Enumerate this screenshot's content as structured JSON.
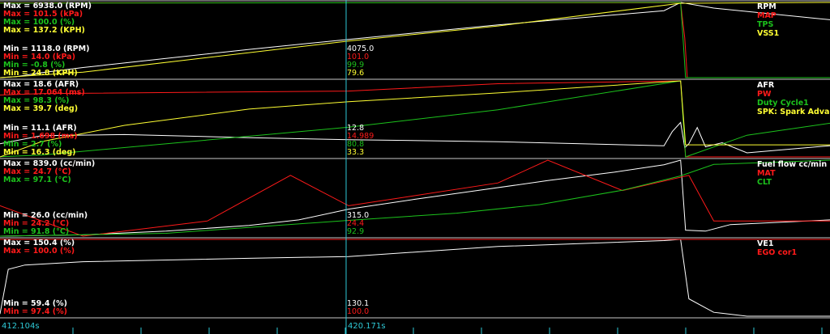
{
  "cursor": {
    "time_label": "420.171s",
    "time": 420.171
  },
  "time_axis": {
    "start_label": "412.104s"
  },
  "colors": {
    "white": "#ffffff",
    "red": "#ff1a1a",
    "green": "#1cc21c",
    "yellow": "#ffff33",
    "cursor": "#2ec9d6",
    "divider": "#c8c8c8"
  },
  "chart_data": [
    {
      "type": "line",
      "panel": "panel-1",
      "series": [
        {
          "name": "RPM",
          "color": "#ffffff",
          "max_label": "Max = 6938.0 (RPM)",
          "min_label": "Min = 1118.0 (RPM)",
          "cursor_value": "4075.0",
          "max": 6938.0,
          "min": 1118.0,
          "points": [
            [
              0,
              1118
            ],
            [
              0.02,
              1200
            ],
            [
              0.05,
              1500
            ],
            [
              0.1,
              1900
            ],
            [
              0.3,
              3300
            ],
            [
              0.42,
              4075
            ],
            [
              0.6,
              5200
            ],
            [
              0.8,
              6300
            ],
            [
              0.82,
              6938
            ],
            [
              0.86,
              6500
            ],
            [
              1.0,
              5600
            ]
          ]
        },
        {
          "name": "MAP",
          "color": "#ff1a1a",
          "max_label": "Max = 101.5 (kPa)",
          "min_label": "Min = 14.0 (kPa)",
          "cursor_value": "101.0",
          "max": 101.5,
          "min": 14.0,
          "points": [
            [
              0,
              101
            ],
            [
              0.82,
              101
            ],
            [
              0.825,
              60
            ],
            [
              0.828,
              14
            ],
            [
              1.0,
              14
            ]
          ]
        },
        {
          "name": "TPS",
          "color": "#1cc21c",
          "max_label": "Max = 100.0 (%)",
          "min_label": "Min = -0.8 (%)",
          "cursor_value": "99.9",
          "max": 100.0,
          "min": -0.8,
          "points": [
            [
              0,
              99
            ],
            [
              0.82,
              100
            ],
            [
              0.823,
              50
            ],
            [
              0.826,
              -0.8
            ],
            [
              1.0,
              -0.8
            ]
          ]
        },
        {
          "name": "VSS1",
          "color": "#ffff33",
          "max_label": "Max = 137.2 (KPH)",
          "min_label": "Min = 24.8 (KPH)",
          "cursor_value": "79.6",
          "max": 137.2,
          "min": 24.8,
          "points": [
            [
              0,
              24.8
            ],
            [
              0.1,
              33
            ],
            [
              0.42,
              79.6
            ],
            [
              0.6,
              102
            ],
            [
              0.82,
              136
            ],
            [
              1.0,
              137.2
            ]
          ]
        }
      ]
    },
    {
      "type": "line",
      "panel": "panel-2",
      "series": [
        {
          "name": "AFR",
          "color": "#ffffff",
          "max_label": "Max = 18.6 (AFR)",
          "min_label": "Min = 11.1 (AFR)",
          "cursor_value": "12.8",
          "max": 18.6,
          "min": 11.1,
          "points": [
            [
              0,
              12.4
            ],
            [
              0.05,
              13.2
            ],
            [
              0.15,
              13.3
            ],
            [
              0.3,
              13.0
            ],
            [
              0.42,
              12.8
            ],
            [
              0.6,
              12.6
            ],
            [
              0.75,
              12.3
            ],
            [
              0.8,
              12.2
            ],
            [
              0.81,
              13.6
            ],
            [
              0.82,
              14.5
            ],
            [
              0.825,
              12.0
            ],
            [
              0.83,
              12.4
            ],
            [
              0.84,
              14.0
            ],
            [
              0.85,
              12.1
            ],
            [
              0.87,
              12.5
            ],
            [
              0.9,
              11.5
            ],
            [
              1.0,
              12.2
            ]
          ]
        },
        {
          "name": "PW",
          "color": "#ff1a1a",
          "max_label": "Max = 17.064 (ms)",
          "min_label": "Min = 1.698 (ms)",
          "cursor_value": "14.989",
          "max": 17.064,
          "min": 1.698,
          "points": [
            [
              0,
              14.2
            ],
            [
              0.05,
              14.5
            ],
            [
              0.42,
              15.0
            ],
            [
              0.6,
              16.5
            ],
            [
              0.82,
              17.064
            ],
            [
              0.826,
              1.698
            ],
            [
              1.0,
              1.698
            ]
          ]
        },
        {
          "name": "Duty Cycle1",
          "color": "#1cc21c",
          "max_label": "Max = 98.3 (%)",
          "min_label": "Min = 2.7 (%)",
          "cursor_value": "80.8",
          "max": 98.3,
          "min": 2.7,
          "points": [
            [
              0,
              3
            ],
            [
              0.05,
              5
            ],
            [
              0.42,
              40
            ],
            [
              0.6,
              62
            ],
            [
              0.82,
              98.3
            ],
            [
              0.826,
              2.7
            ],
            [
              0.9,
              30
            ],
            [
              1.0,
              45
            ]
          ]
        },
        {
          "name": "SPK: Spark Advance",
          "color": "#ffff33",
          "max_label": "Max = 39.7 (deg)",
          "min_label": "Min = 16.3 (deg)",
          "cursor_value": "33.3",
          "max": 39.7,
          "min": 16.3,
          "points": [
            [
              0,
              16.3
            ],
            [
              0.05,
              21
            ],
            [
              0.15,
              26
            ],
            [
              0.3,
              31
            ],
            [
              0.42,
              33.3
            ],
            [
              0.6,
              36
            ],
            [
              0.82,
              39.7
            ],
            [
              0.826,
              20
            ],
            [
              1.0,
              20
            ]
          ]
        }
      ]
    },
    {
      "type": "line",
      "panel": "panel-3",
      "series": [
        {
          "name": "Fuel flow cc/min",
          "color": "#ffffff",
          "max_label": "Max = 839.0 (cc/min)",
          "min_label": "Min = 26.0 (cc/min)",
          "cursor_value": "315.0",
          "max": 839.0,
          "min": 26.0,
          "points": [
            [
              0,
              26
            ],
            [
              0.1,
              40
            ],
            [
              0.2,
              80
            ],
            [
              0.3,
              140
            ],
            [
              0.36,
              200
            ],
            [
              0.42,
              315
            ],
            [
              0.5,
              420
            ],
            [
              0.58,
              520
            ],
            [
              0.66,
              620
            ],
            [
              0.74,
              710
            ],
            [
              0.8,
              790
            ],
            [
              0.82,
              839
            ],
            [
              0.826,
              90
            ],
            [
              0.85,
              80
            ],
            [
              0.88,
              150
            ],
            [
              1.0,
              200
            ]
          ]
        },
        {
          "name": "MAT",
          "color": "#ff1a1a",
          "max_label": "Max = 24.7 (°C)",
          "min_label": "Min = 24.2 (°C)",
          "cursor_value": "24.4",
          "max": 24.7,
          "min": 24.2,
          "points": [
            [
              0,
              24.4
            ],
            [
              0.1,
              24.2
            ],
            [
              0.25,
              24.3
            ],
            [
              0.35,
              24.6
            ],
            [
              0.42,
              24.4
            ],
            [
              0.6,
              24.55
            ],
            [
              0.66,
              24.7
            ],
            [
              0.75,
              24.5
            ],
            [
              0.83,
              24.6
            ],
            [
              0.86,
              24.3
            ],
            [
              1.0,
              24.3
            ]
          ]
        },
        {
          "name": "CLT",
          "color": "#1cc21c",
          "max_label": "Max = 97.1 (°C)",
          "min_label": "Min = 91.8 (°C)",
          "cursor_value": "92.9",
          "max": 97.1,
          "min": 91.8,
          "points": [
            [
              0,
              91.8
            ],
            [
              0.2,
              92.0
            ],
            [
              0.42,
              92.9
            ],
            [
              0.55,
              93.4
            ],
            [
              0.65,
              94.0
            ],
            [
              0.75,
              95.0
            ],
            [
              0.82,
              96.0
            ],
            [
              0.86,
              96.8
            ],
            [
              1.0,
              97.1
            ]
          ]
        }
      ]
    },
    {
      "type": "line",
      "panel": "panel-4",
      "series": [
        {
          "name": "VE1",
          "color": "#ffffff",
          "max_label": "Max = 150.4 (%)",
          "min_label": "Min = 59.4 (%)",
          "cursor_value": "130.1",
          "max": 150.4,
          "min": 59.4,
          "points": [
            [
              0,
              62
            ],
            [
              0.01,
              115
            ],
            [
              0.03,
              120
            ],
            [
              0.1,
              124
            ],
            [
              0.3,
              128
            ],
            [
              0.42,
              130.1
            ],
            [
              0.6,
              142
            ],
            [
              0.8,
              149
            ],
            [
              0.82,
              150.4
            ],
            [
              0.83,
              80
            ],
            [
              0.86,
              64
            ],
            [
              0.9,
              59.4
            ],
            [
              1.0,
              59.4
            ]
          ]
        },
        {
          "name": "EGO cor1",
          "color": "#ff1a1a",
          "max_label": "Max = 100.0 (%)",
          "min_label": "Min = 97.4 (%)",
          "cursor_value": "100.0",
          "max": 100.0,
          "min": 97.4,
          "points": [
            [
              0,
              100
            ],
            [
              1.0,
              100
            ]
          ]
        }
      ]
    }
  ]
}
